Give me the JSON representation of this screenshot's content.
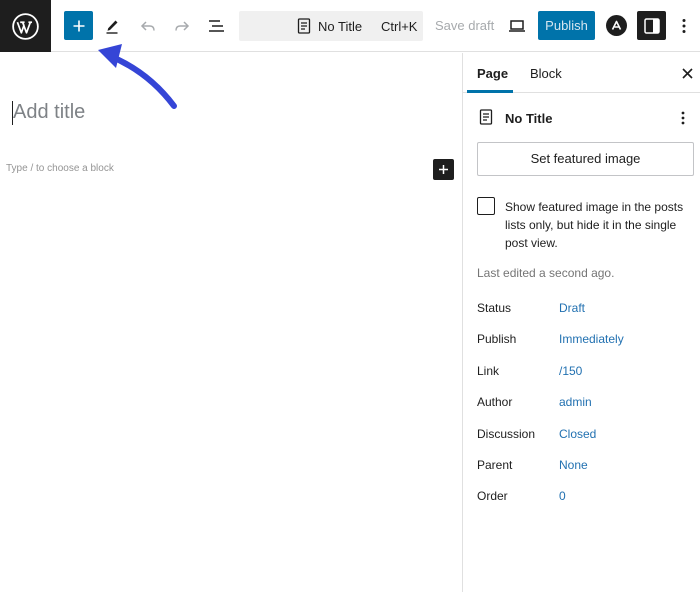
{
  "toolbar": {
    "logo_icon": "wordpress-logo-icon",
    "inserter_icon": "plus-icon",
    "tools_icon": "pencil-icon",
    "undo_icon": "undo-icon",
    "redo_icon": "redo-icon",
    "list_view_icon": "list-view-icon",
    "document_title": "No Title",
    "document_shortcut": "Ctrl+K",
    "save_draft_label": "Save draft",
    "preview_icon": "laptop-icon",
    "publish_label": "Publish",
    "astra_icon": "astra-logo-icon",
    "settings_icon": "sidebar-toggle-icon",
    "options_icon": "kebab-icon",
    "accent_color": "#0073aa"
  },
  "annotation": {
    "arrow_icon": "arrow-icon",
    "arrow_color": "#3545d6"
  },
  "editor": {
    "title_placeholder": "Add title",
    "block_hint": "Type / to choose a block",
    "add_block_icon": "plus-icon"
  },
  "sidebar": {
    "tabs": [
      {
        "label": "Page"
      },
      {
        "label": "Block"
      }
    ],
    "close_icon": "close-icon",
    "summary_title": "No Title",
    "featured_image_label": "Set featured image",
    "featured_check_label": "Show featured image in the posts lists only, but hide it in the single post view.",
    "last_edited": "Last edited a second ago.",
    "properties": [
      {
        "label": "Status",
        "value": "Draft"
      },
      {
        "label": "Publish",
        "value": "Immediately"
      },
      {
        "label": "Link",
        "value": "/150"
      },
      {
        "label": "Author",
        "value": "admin"
      },
      {
        "label": "Discussion",
        "value": "Closed"
      },
      {
        "label": "Parent",
        "value": "None"
      },
      {
        "label": "Order",
        "value": "0"
      }
    ]
  }
}
